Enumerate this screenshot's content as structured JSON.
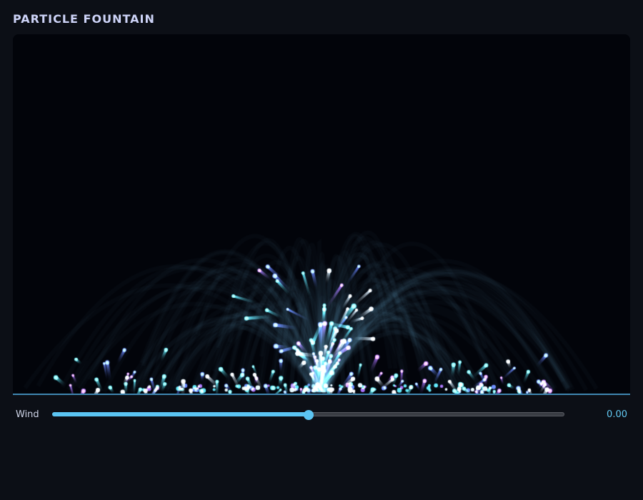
{
  "app": {
    "title": "PARTICLE FOUNTAIN"
  },
  "controls": {
    "wind": {
      "label": "Wind",
      "value": 0,
      "value_text": "0.00",
      "min": -1,
      "max": 1
    }
  },
  "colors": {
    "background": "#0c0f16",
    "canvas_background": "#02040a",
    "ground_line": "#3f86b0",
    "accent": "#5bc4f2",
    "particle_cyan": "#5fe3f0",
    "particle_purple": "#a86ef2",
    "particle_blue": "#6a86ff",
    "particle_white": "#e6f6ff"
  }
}
